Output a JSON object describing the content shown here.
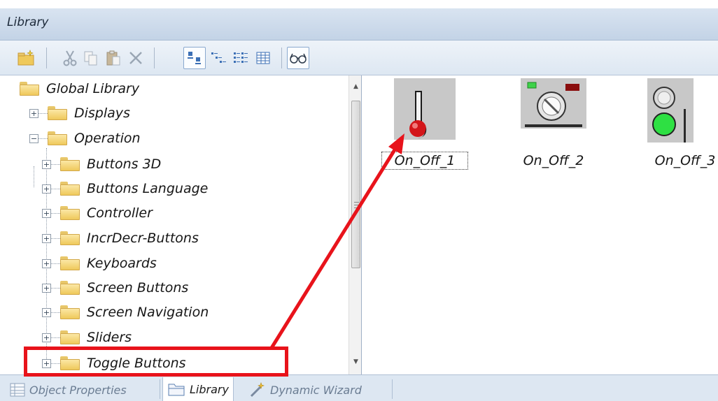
{
  "window": {
    "title": "Library"
  },
  "toolbar": {
    "buttons": [
      {
        "name": "new-folder",
        "icon": "new-folder-icon"
      },
      {
        "name": "cut",
        "icon": "cut-icon"
      },
      {
        "name": "copy",
        "icon": "copy-icon"
      },
      {
        "name": "paste",
        "icon": "paste-icon"
      },
      {
        "name": "delete",
        "icon": "delete-icon"
      },
      {
        "name": "large-icons",
        "icon": "large-icons-view-icon",
        "pressed": true
      },
      {
        "name": "small-icons",
        "icon": "small-icons-view-icon"
      },
      {
        "name": "list",
        "icon": "list-view-icon"
      },
      {
        "name": "details",
        "icon": "details-view-icon"
      },
      {
        "name": "preview",
        "icon": "glasses-icon",
        "pressed": true
      }
    ]
  },
  "tree": {
    "root": "Global Library",
    "displays": "Displays",
    "operation": "Operation",
    "children": [
      "Buttons 3D",
      "Buttons Language",
      "Controller",
      "IncrDecr-Buttons",
      "Keyboards",
      "Screen Buttons",
      "Screen Navigation",
      "Sliders",
      "Toggle Buttons"
    ]
  },
  "items": [
    {
      "label": "On_Off_1",
      "selected": true
    },
    {
      "label": "On_Off_2",
      "selected": false
    },
    {
      "label": "On_Off_3",
      "selected": false
    }
  ],
  "bottom_tabs": [
    {
      "label": "Object Properties",
      "icon": "properties-icon",
      "active": false
    },
    {
      "label": "Library",
      "icon": "library-icon",
      "active": true
    },
    {
      "label": "Dynamic Wizard",
      "icon": "wizard-icon",
      "active": false
    }
  ],
  "colors": {
    "annotation": "#e8131b",
    "title_bar": "#c3d3e6",
    "folder": "#efc95b"
  }
}
